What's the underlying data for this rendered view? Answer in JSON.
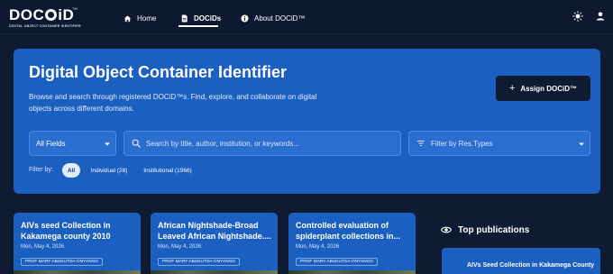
{
  "brand": {
    "logo_text_pre": "DOC",
    "logo_text_post": "iD",
    "logo_tm": "TM",
    "logo_subtitle": "DIGITAL OBJECT CONTAINER IDENTIFIER"
  },
  "nav": {
    "items": [
      {
        "label": "Home",
        "icon": "home-icon"
      },
      {
        "label": "DOCiDs",
        "icon": "document-icon",
        "active": true
      },
      {
        "label": "About DOCiD™",
        "icon": "info-icon"
      }
    ],
    "theme_icon": "sun-icon",
    "user_icon": "user-icon"
  },
  "hero": {
    "title": "Digital Object Container Identifier",
    "description": "Browse and search through registered DOCiD™s. Find, explore, and collaborate on digital objects across different domains.",
    "assign_button": "Assign DOCiD™",
    "field_select": {
      "value": "All Fields"
    },
    "search": {
      "placeholder": "Search by title, author, institution, or keywords..."
    },
    "restype_select": {
      "placeholder": "Filter by Res.Types"
    },
    "filter_label": "Filter by:",
    "filter_chips": [
      {
        "label": "All",
        "selected": true
      },
      {
        "label": "Individual (28)",
        "selected": false
      },
      {
        "label": "Institutional (1966)",
        "selected": false
      }
    ]
  },
  "cards": [
    {
      "title": "AIVs seed Collection in Kakamega county 2010",
      "date": "Mon, May 4, 2026",
      "author": "PROF MARY ABUKUTSA-ONYANGO"
    },
    {
      "title": "African Nightshade-Broad Leaved African Nightshade....",
      "date": "Mon, May 4, 2026",
      "author": "PROF MARY ABUKUTSA-ONYANGO"
    },
    {
      "title": "Controlled evaluation of spiderplant collections in...",
      "date": "Mon, May 4, 2026",
      "author": "PROF MARY ABUKUTSA-ONYANGO"
    }
  ],
  "top_publications": {
    "heading": "Top publications",
    "icon": "eye-icon",
    "first_item": "AIVs Seed Collection in Kakamega County"
  },
  "colors": {
    "background": "#0f1a33",
    "hero": "#1b5fc0",
    "button_dark": "#0f1a33"
  }
}
